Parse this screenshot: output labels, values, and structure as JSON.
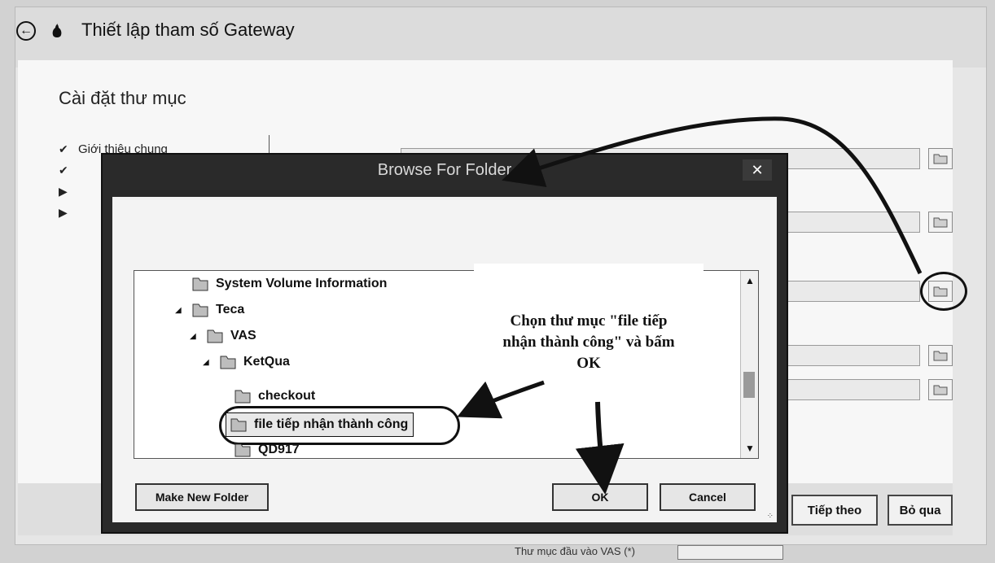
{
  "wizard": {
    "title": "Thiết lập tham số Gateway",
    "section_title": "Cài đặt thư mục",
    "steps": [
      {
        "mark": "✔",
        "label": "Giới thiệu chung"
      },
      {
        "mark": "✔",
        "label": ""
      },
      {
        "mark": "▶",
        "label": ""
      },
      {
        "mark": "▶",
        "label": ""
      }
    ],
    "next_label": "Tiếp theo",
    "skip_label": "Bỏ qua",
    "bottom_field_label": "Thư mục đầu vào VAS (*)"
  },
  "dialog": {
    "title": "Browse For Folder",
    "close_glyph": "✕",
    "tree": [
      {
        "label": "System Volume Information",
        "expander": ""
      },
      {
        "label": "Teca",
        "expander": "◢"
      },
      {
        "label": "VAS",
        "expander": "◢"
      },
      {
        "label": "KetQua",
        "expander": "◢"
      },
      {
        "label": "checkout",
        "expander": ""
      },
      {
        "label": "file tiếp nhận thành công",
        "expander": ""
      },
      {
        "label": "QD917",
        "expander": ""
      }
    ],
    "make_new_folder_label": "Make New Folder",
    "ok_label": "OK",
    "cancel_label": "Cancel"
  },
  "annotation": {
    "text_line1": "Chọn thư mục \"file tiếp",
    "text_line2": "nhận thành công\" và bấm",
    "text_line3": "OK"
  },
  "colors": {
    "dialog_frame": "#2a2a2a",
    "wizard_bg": "#e6e6e6",
    "annotation_ink": "#111111"
  }
}
